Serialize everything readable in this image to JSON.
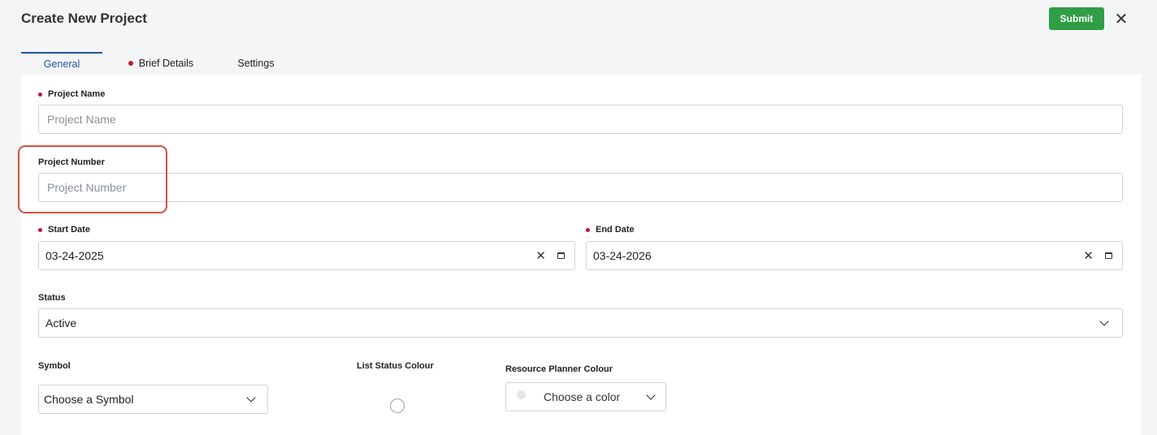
{
  "header": {
    "title": "Create New Project",
    "submit_label": "Submit",
    "close_icon": "close-icon"
  },
  "tabs": [
    {
      "label": "General",
      "active": true,
      "required": false
    },
    {
      "label": "Brief Details",
      "active": false,
      "required": true
    },
    {
      "label": "Settings",
      "active": false,
      "required": false
    }
  ],
  "form": {
    "project_name": {
      "label": "Project Name",
      "placeholder": "Project Name",
      "value": "",
      "required": true
    },
    "project_number": {
      "label": "Project Number",
      "placeholder": "Project Number",
      "value": "",
      "required": false
    },
    "start_date": {
      "label": "Start Date",
      "value": "03-24-2025",
      "required": true
    },
    "end_date": {
      "label": "End Date",
      "value": "03-24-2026",
      "required": true
    },
    "status": {
      "label": "Status",
      "value": "Active"
    },
    "symbol": {
      "label": "Symbol",
      "value": "Choose a Symbol"
    },
    "list_status_colour": {
      "label": "List Status Colour"
    },
    "resource_planner_colour": {
      "label": "Resource Planner Colour",
      "value": "Choose a color"
    }
  },
  "colors": {
    "accent": "#2255a4",
    "submit": "#2f9e44",
    "required_dot": "#c0182a",
    "highlight": "#d9513c"
  }
}
